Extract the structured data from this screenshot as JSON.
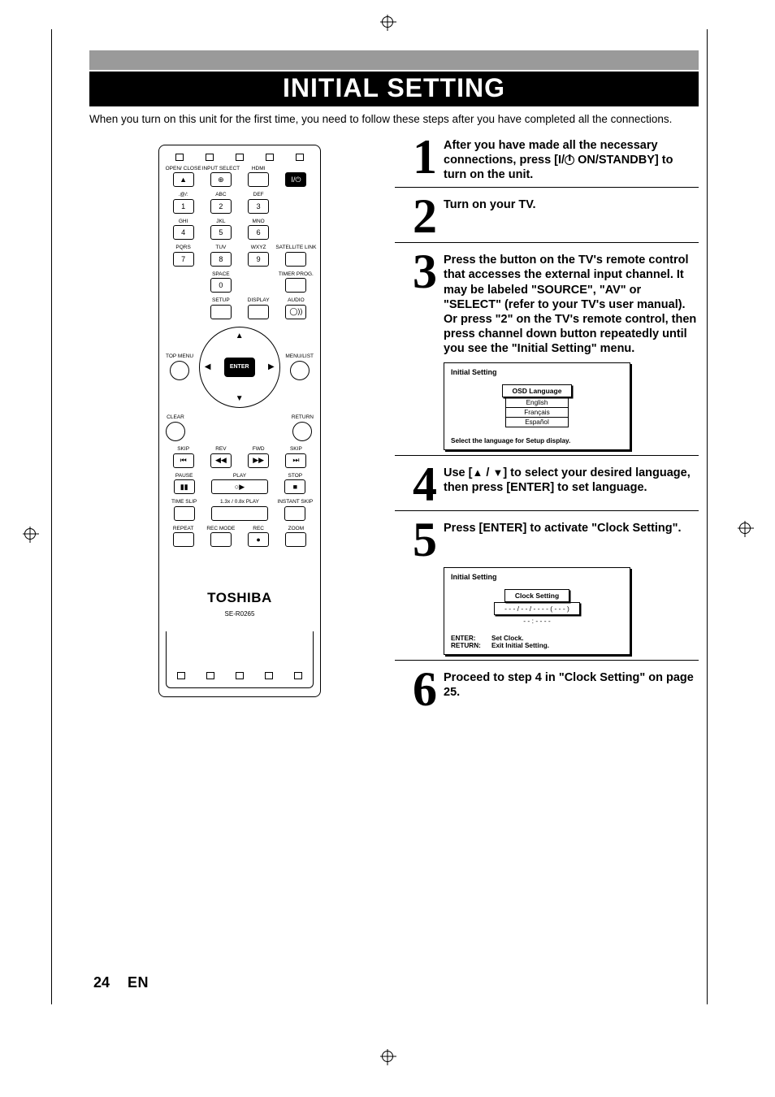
{
  "banner_title": "INITIAL SETTING",
  "intro_text": "When you turn on this unit for the first time, you need to follow these steps after you have completed all the connections.",
  "remote": {
    "brand": "TOSHIBA",
    "model": "SE-R0265",
    "rows": {
      "r1": {
        "open_close": "OPEN/\nCLOSE",
        "input_select": "INPUT\nSELECT",
        "hdmi": "HDMI",
        "power_glyph": "I/⏻"
      },
      "r2": {
        "k1_label": ".@/:",
        "k1": "1",
        "k2_label": "ABC",
        "k2": "2",
        "k3_label": "DEF",
        "k3": "3"
      },
      "r3": {
        "k4_label": "GHI",
        "k4": "4",
        "k5_label": "JKL",
        "k5": "5",
        "k6_label": "MNO",
        "k6": "6"
      },
      "r4": {
        "k7_label": "PQRS",
        "k7": "7",
        "k8_label": "TUV",
        "k8": "8",
        "k9_label": "WXYZ",
        "k9": "9",
        "sat": "SATELLITE\nLINK"
      },
      "r5": {
        "space": "SPACE",
        "k0": "0",
        "timer": "TIMER\nPROG."
      },
      "r6": {
        "setup": "SETUP",
        "display": "DISPLAY",
        "audio": "AUDIO",
        "audio_glyph": "◯))"
      },
      "nav": {
        "topmenu": "TOP MENU",
        "menulist": "MENU/LIST",
        "enter": "ENTER",
        "clear": "CLEAR",
        "return": "RETURN"
      },
      "r7": {
        "skip_l": "SKIP",
        "skip_l_g": "⏮",
        "rev": "REV",
        "rev_g": "◀◀",
        "fwd": "FWD",
        "fwd_g": "▶▶",
        "skip_r": "SKIP",
        "skip_r_g": "⏭"
      },
      "r8": {
        "pause": "PAUSE",
        "pause_g": "▮▮",
        "play": "PLAY",
        "play_g": " ▶",
        "play_g_circ": "○",
        "stop": "STOP",
        "stop_g": "■"
      },
      "r9": {
        "timeslip": "TIME SLIP",
        "mid": "1.3x / 0.8x PLAY",
        "instant": "INSTANT SKIP"
      },
      "r10": {
        "repeat": "REPEAT",
        "recmode": "REC MODE",
        "rec": "REC",
        "rec_g": "●",
        "zoom": "ZOOM"
      }
    }
  },
  "steps": {
    "s1": {
      "num": "1",
      "text_a": "After you have made all the necessary connections, press [I/",
      "text_b": " ON/STANDBY] to turn on the unit."
    },
    "s2": {
      "num": "2",
      "text": "Turn on your TV."
    },
    "s3": {
      "num": "3",
      "text": "Press the button on the TV's remote control that accesses the external input channel. It may be labeled \"SOURCE\", \"AV\" or \"SELECT\" (refer to your TV's user manual). Or press \"2\" on the TV's remote control, then press channel down button repeatedly until you see the \"Initial Setting\" menu."
    },
    "s4": {
      "num": "4",
      "text_a": "Use [",
      "up": "▲",
      "slash": " / ",
      "down": "▼",
      "text_b": "] to select your desired language, then press [ENTER] to set language."
    },
    "s5": {
      "num": "5",
      "text": "Press [ENTER] to activate \"Clock Setting\"."
    },
    "s6": {
      "num": "6",
      "text": "Proceed to step 4 in \"Clock Setting\" on page 25."
    }
  },
  "osd1": {
    "title": "Initial Setting",
    "header": "OSD Language",
    "opts": [
      "English",
      "Français",
      "Español"
    ],
    "footer": "Select the language for Setup display."
  },
  "osd2": {
    "title": "Initial Setting",
    "header": "Clock Setting",
    "line1": "- - - / - - / - - - -  ( - - - )",
    "line2": "- - : - -  - -",
    "footer1_label": "ENTER:",
    "footer1_text": "Set Clock.",
    "footer2_label": "RETURN:",
    "footer2_text": "Exit Initial Setting."
  },
  "page_footer": {
    "num": "24",
    "lang": "EN"
  }
}
